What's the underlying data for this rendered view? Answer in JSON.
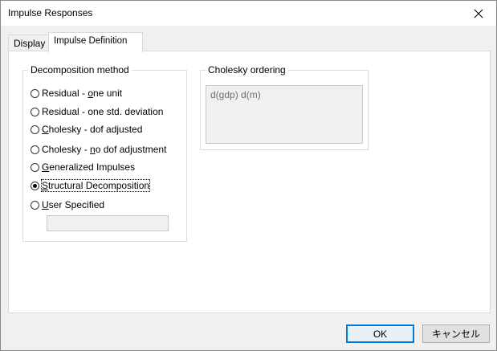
{
  "window": {
    "title": "Impulse Responses",
    "close_icon": "close-icon"
  },
  "tabs": [
    {
      "label": "Display",
      "active": false
    },
    {
      "label": "Impulse Definition",
      "active": true
    }
  ],
  "decomposition": {
    "legend": "Decomposition method",
    "options": [
      {
        "pre": "Residual - ",
        "key": "o",
        "post": "ne unit",
        "checked": false
      },
      {
        "pre": "Residual - one std. deviation",
        "key": "",
        "post": "",
        "checked": false
      },
      {
        "pre": "",
        "key": "C",
        "post": "holesky - dof adjusted",
        "checked": false
      },
      {
        "pre": "Cholesky - ",
        "key": "n",
        "post": "o dof adjustment",
        "checked": false
      },
      {
        "pre": "",
        "key": "G",
        "post": "eneralized Impulses",
        "checked": false
      },
      {
        "pre": "",
        "key": "S",
        "post": "tructural Decomposition",
        "checked": true
      },
      {
        "pre": "",
        "key": "U",
        "post": "ser Specified",
        "checked": false
      }
    ],
    "user_specified_value": ""
  },
  "cholesky": {
    "legend": "Cholesky ordering",
    "ordering": "d(gdp) d(m)"
  },
  "buttons": {
    "ok": "OK",
    "cancel": "キャンセル"
  }
}
